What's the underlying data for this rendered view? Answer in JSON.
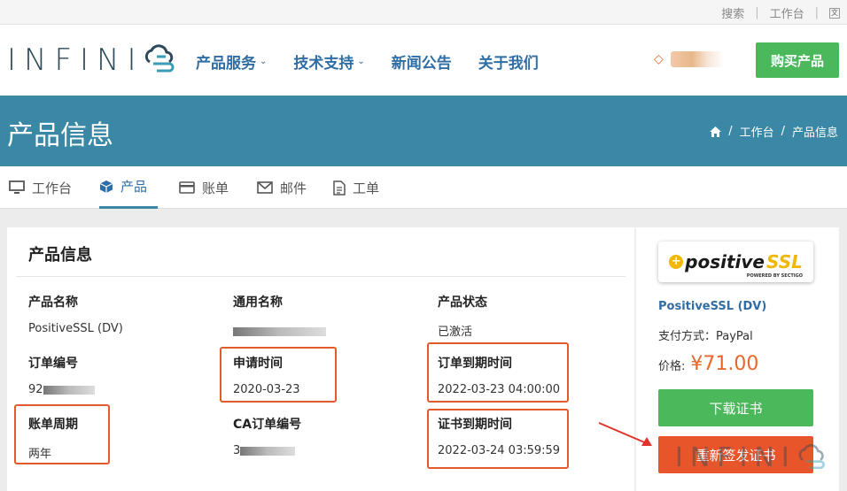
{
  "topbar": {
    "search": "搜索",
    "workbench": "工作台"
  },
  "nav": {
    "logo": "INFINI",
    "items": [
      {
        "label": "产品服务",
        "has_caret": true
      },
      {
        "label": "技术支持",
        "has_caret": true
      },
      {
        "label": "新闻公告",
        "has_caret": false
      },
      {
        "label": "关于我们",
        "has_caret": false
      }
    ],
    "buy": "购买产品"
  },
  "banner": {
    "title": "产品信息",
    "breadcrumb": [
      "工作台",
      "产品信息"
    ]
  },
  "tabs": [
    "工作台",
    "产品",
    "账单",
    "邮件",
    "工单"
  ],
  "card": {
    "title": "产品信息",
    "fields": {
      "product_name": {
        "label": "产品名称",
        "value": "PositiveSSL (DV)"
      },
      "common_name": {
        "label": "通用名称",
        "value": ""
      },
      "status": {
        "label": "产品状态",
        "value": "已激活"
      },
      "order_no": {
        "label": "订单编号",
        "value": "92"
      },
      "apply_time": {
        "label": "申请时间",
        "value": "2020-03-23"
      },
      "order_expire": {
        "label": "订单到期时间",
        "value": "2022-03-23 04:00:00"
      },
      "billing_cycle": {
        "label": "账单周期",
        "value": "两年"
      },
      "ca_order": {
        "label": "CA订单编号",
        "value": "3"
      },
      "cert_expire": {
        "label": "证书到期时间",
        "value": "2022-03-24 03:59:59"
      }
    }
  },
  "side": {
    "logo_text": "positive",
    "logo_ssl": "SSL",
    "logo_sub": "POWERED BY SECTIGO",
    "product": "PositiveSSL (DV)",
    "payment": "支付方式：PayPal",
    "price_label": "价格:",
    "price": "¥71.00",
    "download": "下载证书",
    "reissue": "重新签发证书"
  },
  "colors": {
    "banner": "#3a88a5",
    "green": "#4cb85c",
    "orange": "#e8552a",
    "link": "#2f6ea5"
  }
}
